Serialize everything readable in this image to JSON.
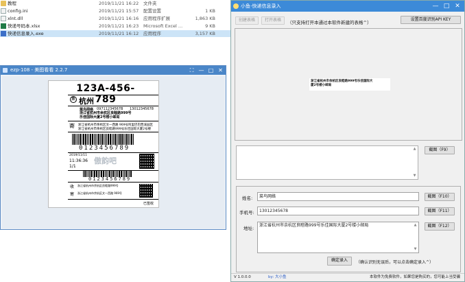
{
  "explorer": {
    "files": [
      {
        "name": "教程",
        "date": "2019/11/21 16:22",
        "type": "文件夹",
        "size": "",
        "icon": "folder-icon"
      },
      {
        "name": "config.ini",
        "date": "2019/11/21 15:57",
        "type": "配置设置",
        "size": "1 KB",
        "icon": "ini-file-icon"
      },
      {
        "name": "xlnt.dll",
        "date": "2019/11/21 16:16",
        "type": "应用程序扩展",
        "size": "1,863 KB",
        "icon": "dll-file-icon"
      },
      {
        "name": "快递号码本.xlsx",
        "date": "2019/11/21 16:23",
        "type": "Microsoft Excel ...",
        "size": "9 KB",
        "icon": "excel-file-icon"
      },
      {
        "name": "快递信息录入.exe",
        "date": "2019/11/21 16:12",
        "type": "应用程序",
        "size": "3,157 KB",
        "icon": "exe-file-icon",
        "selected": true
      }
    ]
  },
  "viewer": {
    "title": "ezp-108 - 美图看看 2.2.7",
    "controls": {
      "restore": "⛶",
      "minimize": "—",
      "maximize": "□",
      "close": "✕"
    }
  },
  "waybill": {
    "tracking": "123A-456-789",
    "collect_mark": "集",
    "city": "杭州",
    "recipient_name": "菜鸟网络",
    "recipient_phone1": "09711234567B",
    "recipient_phone2": "13012345678",
    "recipient_address": "浙江省杭州市余杭区良睦路999号乐佳国际大厦2号楼小邮局",
    "sender_mark": "寄",
    "sender_line1": "浙江省杭州市余杭区文一西路 969号阿里巴巴西溪园区",
    "sender_line2": "浙江省杭州市余杭区良睦路999号乐佳国际大厦2号楼",
    "barcode_digits": "0123456789",
    "info_date": "2019/11/11",
    "info_time": "11:36:36",
    "info_page": "1/1",
    "watermark": "傲韵吧",
    "receive_mark": "收",
    "sender_mark2": "寄",
    "signed": "已签收",
    "small_line1": "浙江省杭州市余杭区良睦路999号",
    "small_line2": "浙江省杭州市余杭区文一西路 969号"
  },
  "app": {
    "title": "小鱼-快递信息录入",
    "toolbar": {
      "create_label": "创建表格",
      "open_label": "打开表格",
      "hint": "（只支持打开本通过本软件新建的表格^）",
      "api_label": "设置百度识别API KEY"
    },
    "preview_text_line1": "浙江省杭州市余杭区良睦路999号乐佳国际大",
    "preview_text_line2": "厦2号楼小邮局",
    "screenshot_f9": "截图（F9）",
    "name_label": "姓名:",
    "name_value": "菜鸟网络",
    "screenshot_f10": "截图（F10）",
    "phone_label": "手机号:",
    "phone_value": "13012345678",
    "screenshot_f11": "截图（F11）",
    "address_label": "地址:",
    "address_value": "浙江省杭州市余杭区良睦路999号乐佳国际大厦2号楼小邮局",
    "screenshot_f12": "截图（F12）",
    "confirm_label": "确定录入",
    "confirm_hint": "（确认识别无误后，可以点击确定录入^）",
    "status_version": "V 1.0.0.0",
    "status_author": "by: 大小鱼",
    "status_note": "本软件为免费软件，如果您是购买的，您可能上当受骗",
    "controls": {
      "minimize": "—",
      "maximize": "□",
      "close": "✕"
    }
  },
  "colors": {
    "selected_row": "#cce4f7",
    "viewer_titlebar": "#4a86c8",
    "app_titlebar": "#3c8ad8"
  }
}
